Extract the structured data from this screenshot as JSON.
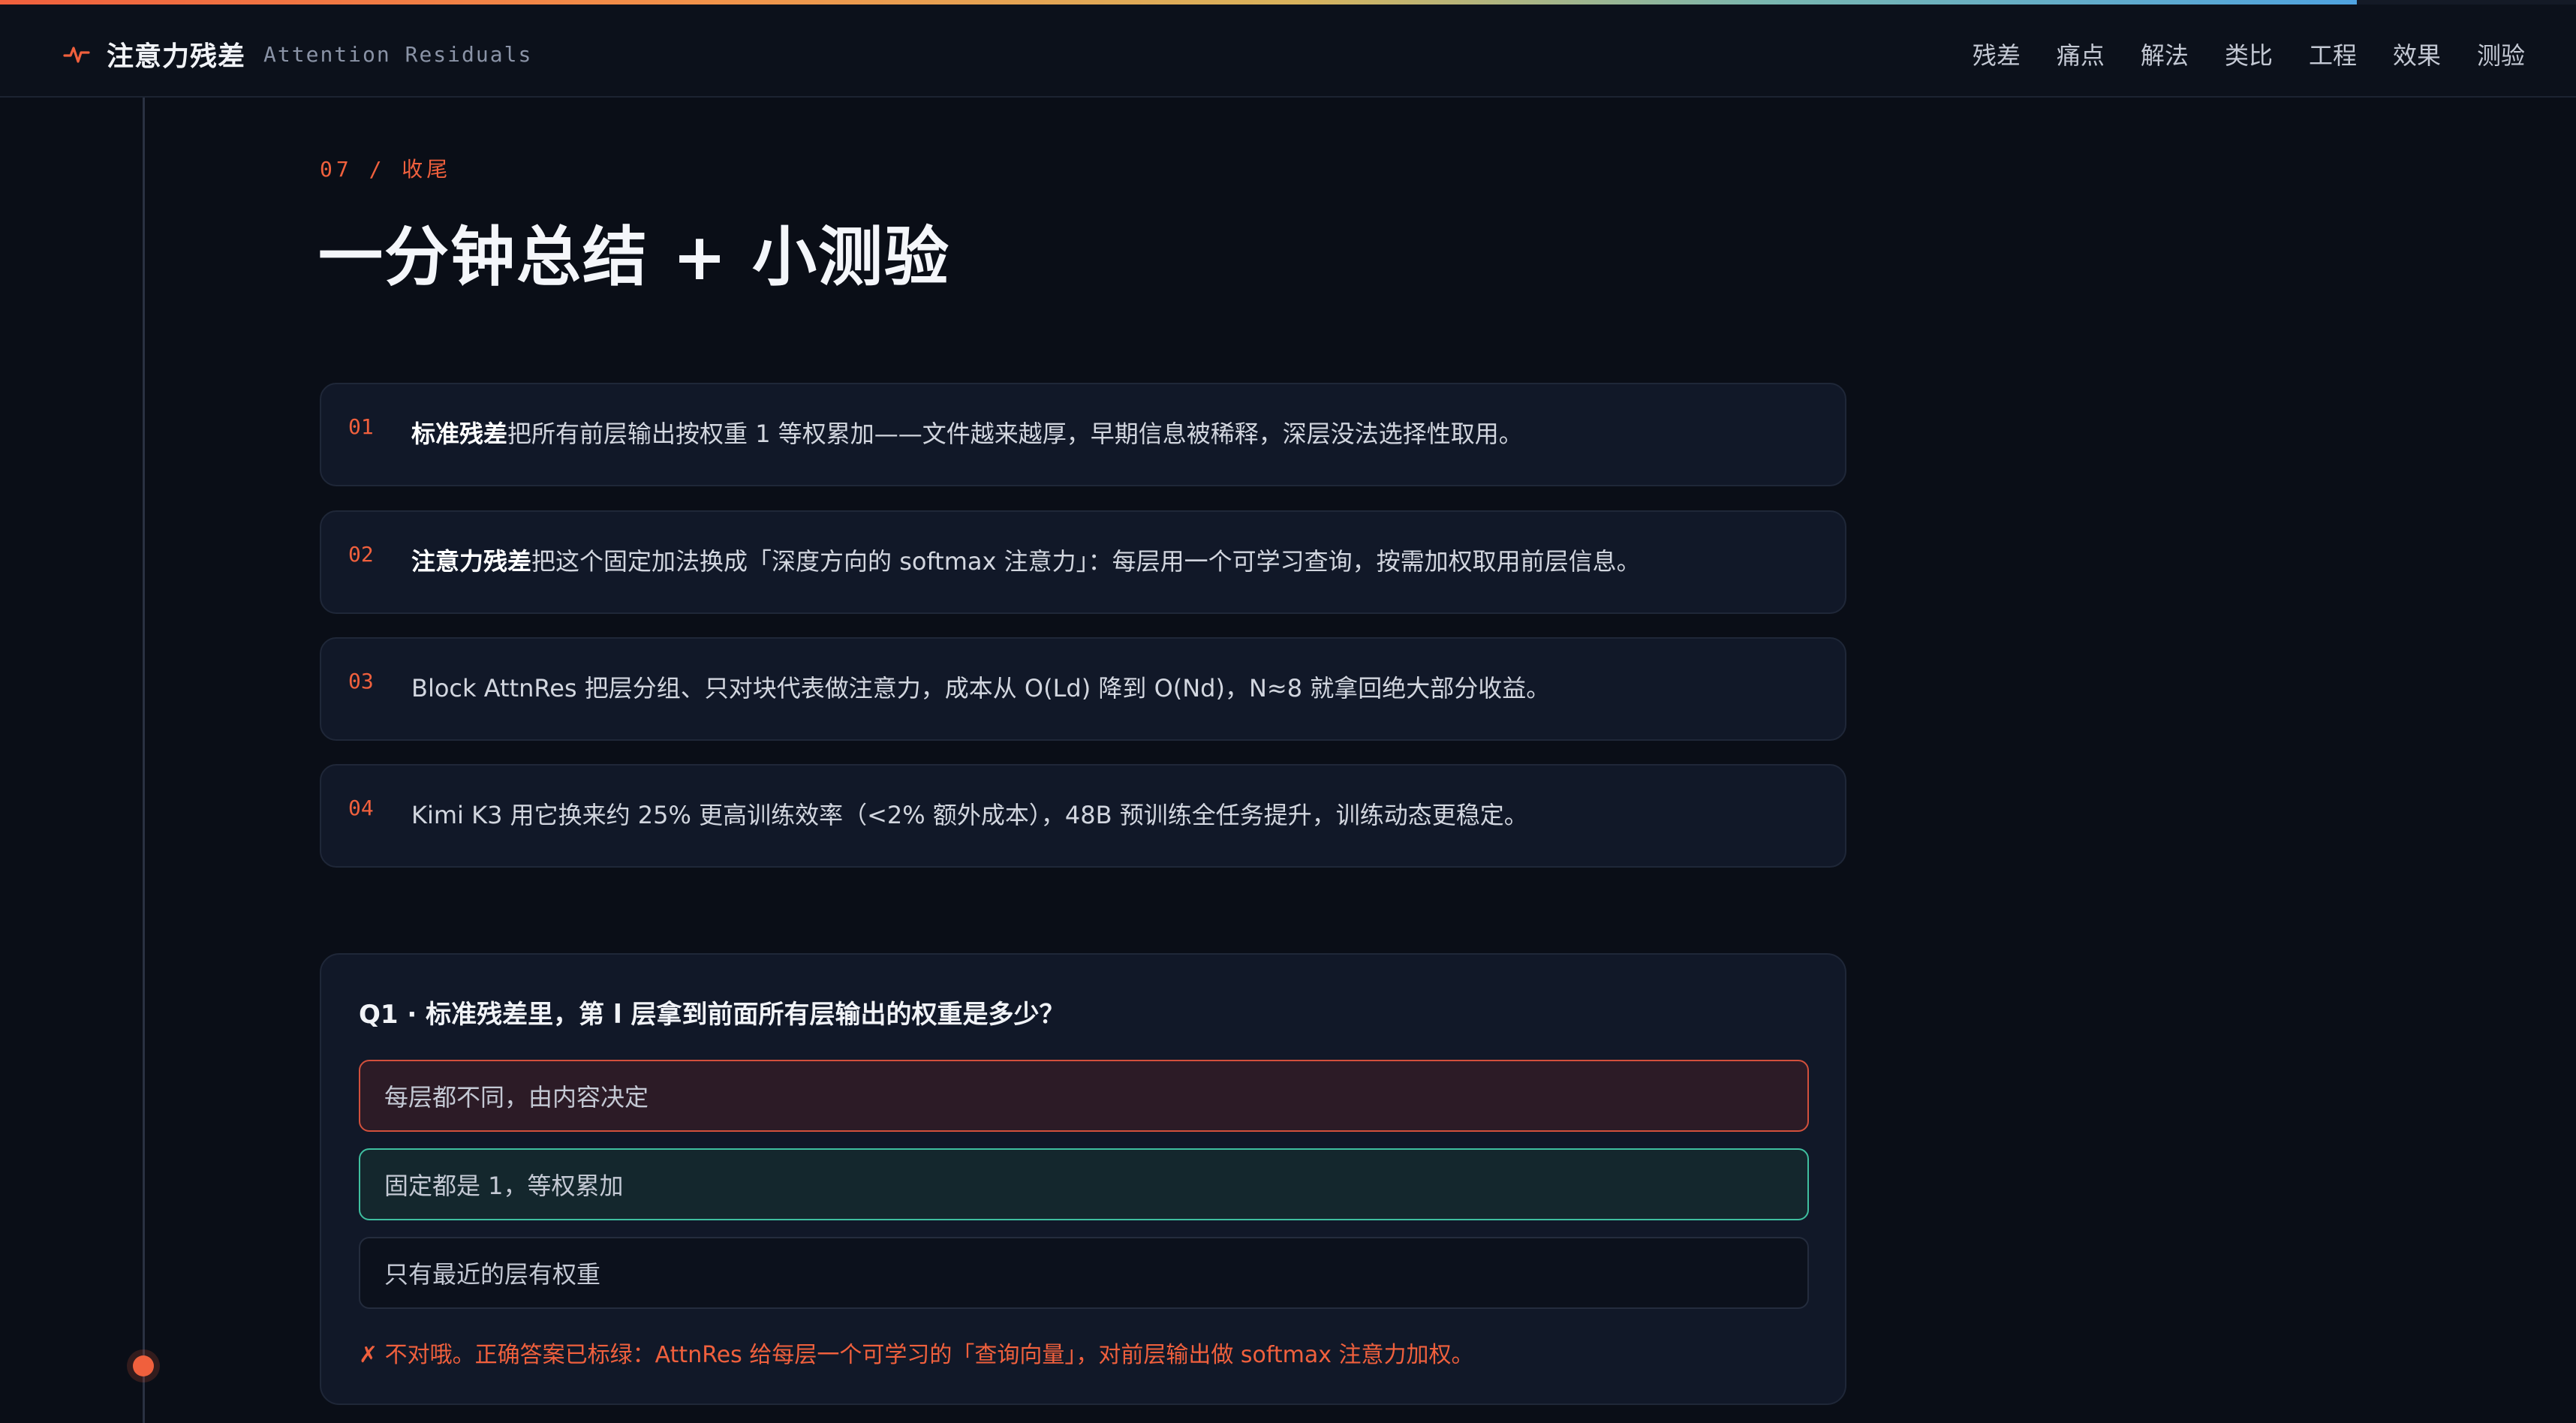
{
  "brand": {
    "title": "注意力残差",
    "subtitle": "Attention Residuals",
    "icon": "pulse-icon",
    "accent_color": "#f0603d"
  },
  "reading_progress_percent": 91.5,
  "nav": {
    "items": [
      "残差",
      "痛点",
      "解法",
      "类比",
      "工程",
      "效果",
      "测验"
    ]
  },
  "section": {
    "eyebrow": "07 / 收尾",
    "title": "一分钟总结 + 小测验"
  },
  "summary": [
    {
      "num": "01",
      "bold": "标准残差",
      "text": "把所有前层输出按权重 1 等权累加——文件越来越厚，早期信息被稀释，深层没法选择性取用。"
    },
    {
      "num": "02",
      "bold": "注意力残差",
      "text": "把这个固定加法换成「深度方向的 softmax 注意力」：每层用一个可学习查询，按需加权取用前层信息。"
    },
    {
      "num": "03",
      "bold": "",
      "text": "Block AttnRes 把层分组、只对块代表做注意力，成本从 O(Ld) 降到 O(Nd)，N≈8 就拿回绝大部分收益。"
    },
    {
      "num": "04",
      "bold": "",
      "text": "Kimi K3 用它换来约 25% 更高训练效率（<2% 额外成本），48B 预训练全任务提升，训练动态更稳定。"
    }
  ],
  "quiz": {
    "question": "Q1 · 标准残差里，第 l 层拿到前面所有层输出的权重是多少？",
    "options": [
      {
        "label": "每层都不同，由内容决定",
        "state": "wrong"
      },
      {
        "label": "固定都是 1，等权累加",
        "state": "correct"
      },
      {
        "label": "只有最近的层有权重",
        "state": "neutral"
      }
    ],
    "feedback": "✗ 不对哦。正确答案已标绿：AttnRes 给每层一个可学习的「查询向量」，对前层输出做 softmax 注意力加权。",
    "colors": {
      "wrong": "#d2503c",
      "correct": "#3fbf9f"
    }
  }
}
